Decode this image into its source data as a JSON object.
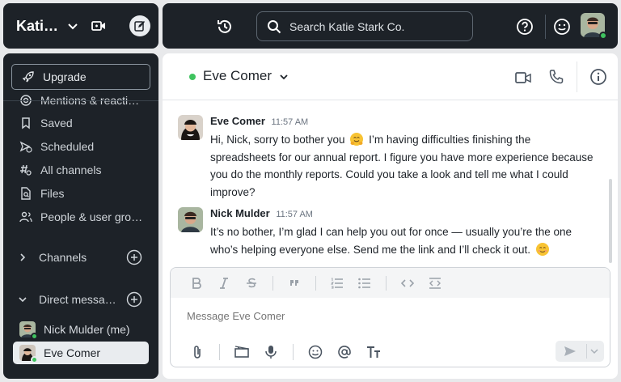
{
  "workspace": {
    "name": "Kati…"
  },
  "search": {
    "placeholder": "Search Katie Stark Co."
  },
  "sidebar": {
    "upgrade_label": "Upgrade",
    "items": [
      {
        "label": "Mentions & reacti…",
        "icon": "at-icon"
      },
      {
        "label": "Saved",
        "icon": "bookmark-icon"
      },
      {
        "label": "Scheduled",
        "icon": "scheduled-send-icon"
      },
      {
        "label": "All channels",
        "icon": "channel-search-icon"
      },
      {
        "label": "Files",
        "icon": "file-search-icon"
      },
      {
        "label": "People & user gro…",
        "icon": "people-icon"
      }
    ],
    "channels_label": "Channels",
    "dms_label": "Direct messa…",
    "dms": [
      {
        "label": "Nick Mulder (me)"
      },
      {
        "label": "Eve Comer"
      }
    ]
  },
  "channel": {
    "title": "Eve Comer"
  },
  "messages": [
    {
      "author": "Eve Comer",
      "time": "11:57 AM",
      "text_a": "Hi, Nick, sorry to bother you",
      "emoji": "hugging-face-emoji",
      "text_b": "I’m having difficulties finishing the spreadsheets for our annual report. I figure you have more experience because you do the monthly reports. Could you take a look and tell me what I could improve?"
    },
    {
      "author": "Nick Mulder",
      "time": "11:57 AM",
      "text_a": "It’s no bother, I’m glad I can help you out for once — usually you’re the one who’s helping everyone else. Send me the link and I’ll check it out.",
      "emoji": "smiling-face-emoji",
      "text_b": ""
    }
  ],
  "composer": {
    "placeholder": "Message Eve Comer"
  },
  "colors": {
    "sidebar_bg": "#1d2228",
    "presence": "#3fc35f",
    "active_item_bg": "#e9ecef"
  }
}
